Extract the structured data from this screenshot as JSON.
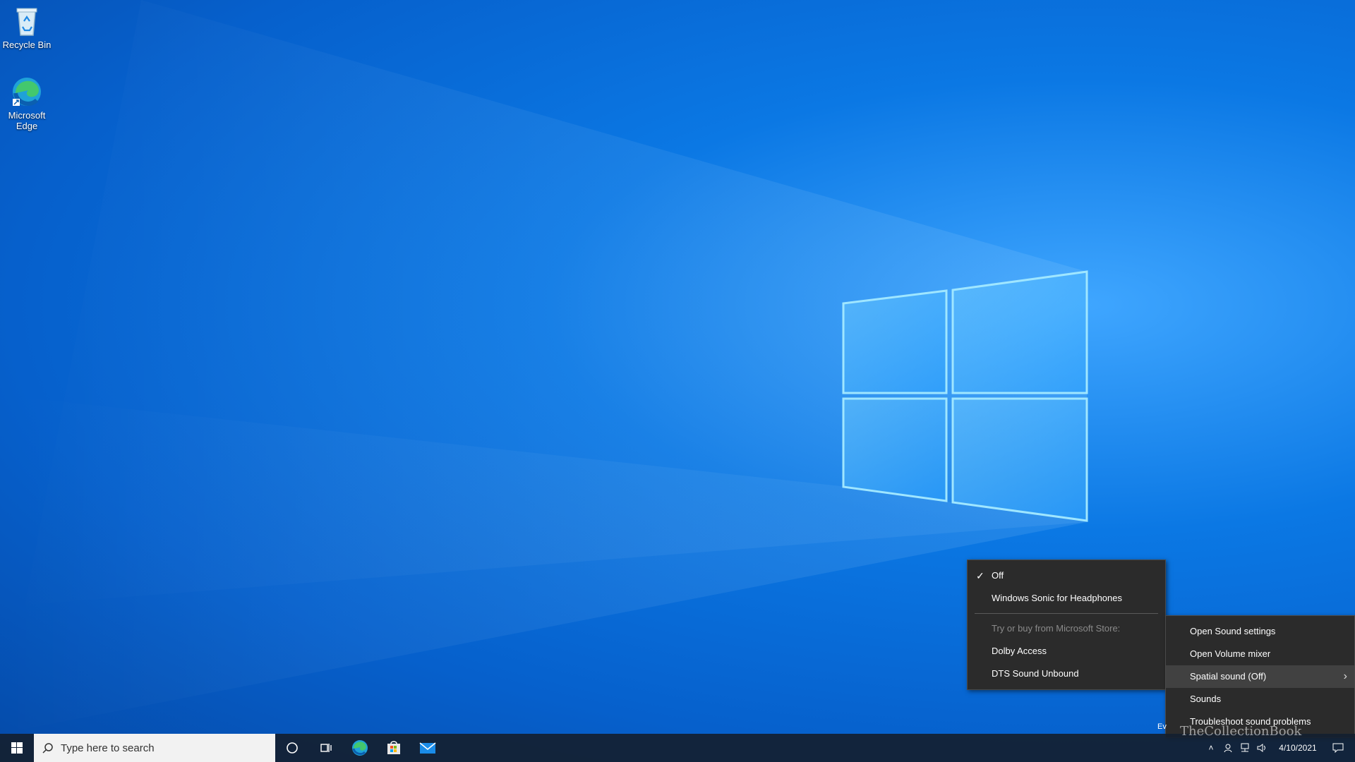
{
  "desktop": {
    "icons": [
      {
        "label": "Recycle Bin",
        "icon": "recycle-bin-icon"
      },
      {
        "label": "Microsoft Edge",
        "icon": "edge-icon"
      }
    ]
  },
  "spatial_submenu": {
    "items": [
      {
        "label": "Off",
        "checked": true
      },
      {
        "label": "Windows Sonic for Headphones"
      },
      {
        "label": "Try or buy from Microsoft Store:",
        "disabled": true
      },
      {
        "label": "Dolby Access"
      },
      {
        "label": "DTS Sound Unbound"
      }
    ]
  },
  "sound_menu": {
    "items": [
      {
        "label": "Open Sound settings"
      },
      {
        "label": "Open Volume mixer"
      },
      {
        "label": "Spatial sound (Off)",
        "submenu": true
      },
      {
        "label": "Sounds"
      },
      {
        "label": "Troubleshoot sound problems"
      }
    ]
  },
  "taskbar": {
    "search_placeholder": "Type here to search",
    "apps": [
      "cortana-icon",
      "task-view-icon",
      "edge-icon",
      "store-icon",
      "mail-icon"
    ],
    "clock": {
      "time": "",
      "date": "4/10/2021"
    }
  },
  "overlay": {
    "ev_text": "Ev",
    "watermark": "TheCollectionBook"
  },
  "colors": {
    "menu_bg": "#2b2b2b",
    "menu_hover": "#414141",
    "taskbar_bg": "#142030",
    "desktop_blue": "#0b78e4"
  }
}
